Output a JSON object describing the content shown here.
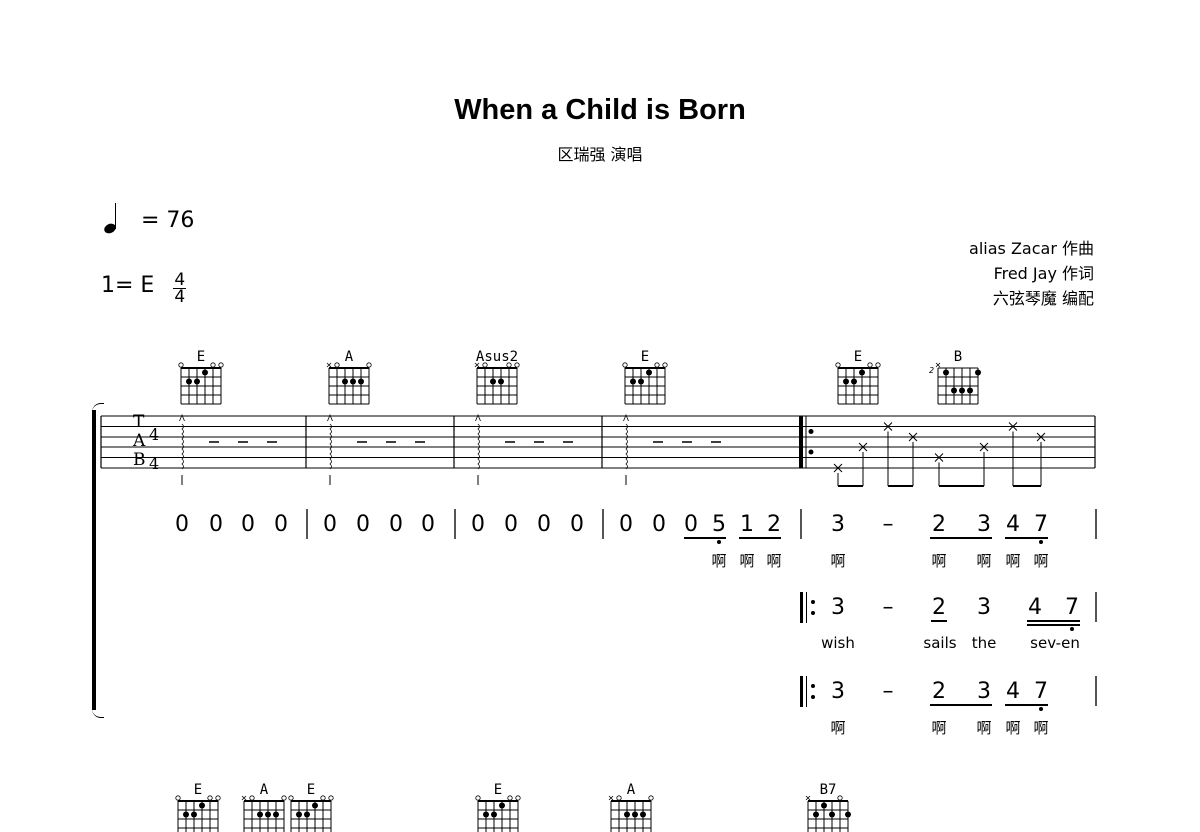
{
  "header": {
    "title": "When a Child is Born",
    "subtitle": "区瑞强  演唱",
    "tempo": "= 76",
    "tempo_icon": "quarter-note-icon",
    "key": "1= E",
    "time_signature": {
      "top": "4",
      "bottom": "4"
    },
    "credits": [
      "alias Zacar  作曲",
      "Fred Jay  作词",
      "六弦琴魔  编配"
    ]
  },
  "tab_clef": {
    "letters": [
      "T",
      "A",
      "B"
    ],
    "time": [
      "4",
      "4"
    ]
  },
  "chords_top": [
    {
      "name": "E",
      "markers": [
        "o",
        "",
        "",
        "",
        "o",
        "o"
      ],
      "dots": [
        [
          1,
          2
        ],
        [
          2,
          2
        ],
        [
          3,
          1
        ]
      ]
    },
    {
      "name": "A",
      "markers": [
        "x",
        "o",
        "",
        "",
        "",
        "o"
      ],
      "dots": [
        [
          2,
          2
        ],
        [
          3,
          2
        ],
        [
          4,
          2
        ]
      ]
    },
    {
      "name": "Asus2",
      "markers": [
        "x",
        "o",
        "",
        "",
        "o",
        "o"
      ],
      "dots": [
        [
          2,
          2
        ],
        [
          3,
          2
        ]
      ]
    },
    {
      "name": "E",
      "markers": [
        "o",
        "",
        "",
        "",
        "o",
        "o"
      ],
      "dots": [
        [
          1,
          2
        ],
        [
          2,
          2
        ],
        [
          3,
          1
        ]
      ]
    },
    {
      "name": "E",
      "markers": [
        "o",
        "",
        "",
        "",
        "o",
        "o"
      ],
      "dots": [
        [
          1,
          2
        ],
        [
          2,
          2
        ],
        [
          3,
          1
        ]
      ]
    },
    {
      "name": "B",
      "fret": "2",
      "markers": [
        "x",
        "",
        "",
        "",
        "",
        ""
      ],
      "dots": [
        [
          1,
          1
        ],
        [
          2,
          3
        ],
        [
          3,
          3
        ],
        [
          4,
          3
        ],
        [
          5,
          1
        ]
      ]
    }
  ],
  "chords_bottom": [
    {
      "name": "E",
      "markers": [
        "o",
        "",
        "",
        "",
        "o",
        "o"
      ],
      "dots": [
        [
          1,
          2
        ],
        [
          2,
          2
        ],
        [
          3,
          1
        ]
      ]
    },
    {
      "name": "A",
      "markers": [
        "x",
        "o",
        "",
        "",
        "",
        "o"
      ],
      "dots": [
        [
          2,
          2
        ],
        [
          3,
          2
        ],
        [
          4,
          2
        ]
      ]
    },
    {
      "name": "E",
      "markers": [
        "o",
        "",
        "",
        "",
        "o",
        "o"
      ],
      "dots": [
        [
          1,
          2
        ],
        [
          2,
          2
        ],
        [
          3,
          1
        ]
      ]
    },
    {
      "name": "E",
      "markers": [
        "o",
        "",
        "",
        "",
        "o",
        "o"
      ],
      "dots": [
        [
          1,
          2
        ],
        [
          2,
          2
        ],
        [
          3,
          1
        ]
      ]
    },
    {
      "name": "A",
      "markers": [
        "x",
        "o",
        "",
        "",
        "",
        "o"
      ],
      "dots": [
        [
          2,
          2
        ],
        [
          3,
          2
        ],
        [
          4,
          2
        ]
      ]
    },
    {
      "name": "B7",
      "markers": [
        "x",
        "",
        "",
        "",
        "o",
        ""
      ],
      "dots": [
        [
          2,
          1
        ],
        [
          1,
          2
        ],
        [
          3,
          2
        ],
        [
          5,
          2
        ]
      ]
    }
  ],
  "tab": {
    "rest_marks": "–",
    "tab_notes": [
      6,
      4,
      2,
      3,
      5,
      4,
      2,
      3
    ]
  },
  "jianpu": {
    "row1": {
      "notes": [
        "0",
        "0",
        "0",
        "0",
        "0",
        "0",
        "0",
        "0",
        "0",
        "0",
        "0",
        "0",
        "0",
        "0",
        "0",
        "5",
        "1",
        "2",
        "3",
        "–",
        "2",
        "3",
        "4",
        "7"
      ],
      "lyrics": [
        "啊",
        "啊",
        "啊",
        "啊",
        "啊",
        "啊",
        "啊",
        "啊"
      ]
    },
    "row2": {
      "notes": [
        "3",
        "–",
        "2",
        "3",
        "4",
        "7"
      ],
      "lyrics": [
        "wish",
        "sails",
        "the",
        "sev-en"
      ]
    },
    "row3": {
      "notes": [
        "3",
        "–",
        "2",
        "3",
        "4",
        "7"
      ],
      "lyrics": [
        "啊",
        "啊",
        "啊",
        "啊",
        "啊"
      ]
    }
  }
}
